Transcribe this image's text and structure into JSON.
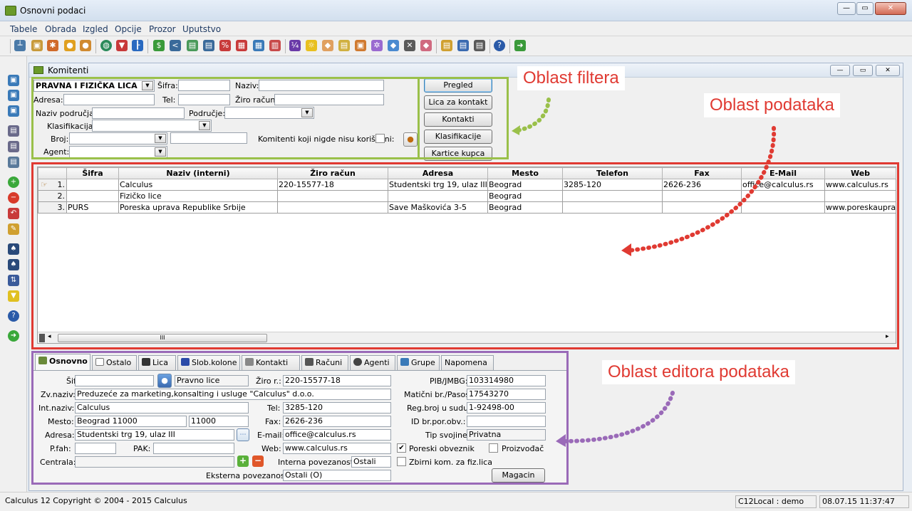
{
  "window": {
    "title": "Osnovni podaci"
  },
  "menu": [
    "Tabele",
    "Obrada",
    "Izgled",
    "Opcije",
    "Prozor",
    "Uputstvo"
  ],
  "child_window": {
    "title": "Komitenti"
  },
  "filter": {
    "type_value": "PRAVNA I FIZIČKA LICA",
    "sifra_label": "Šifra:",
    "naziv_label": "Naziv:",
    "adresa_label": "Adresa:",
    "tel_label": "Tel:",
    "ziro_label": "Žiro račun:",
    "naziv_podrucja_label": "Naziv područja:",
    "podrucje_label": "Područje:",
    "klasifikacija_label": "Klasifikacija:",
    "broj_label": "Broj:",
    "agent_label": "Agent:",
    "unused_label": "Komitenti koji nigde nisu korišćeni:"
  },
  "buttons": [
    "Pregled",
    "Lica za kontakt",
    "Kontakti",
    "Klasifikacije",
    "Kartice kupca"
  ],
  "callouts": {
    "filter": "Oblast filtera",
    "data": "Oblast podataka",
    "editor": "Oblast editora podataka"
  },
  "grid": {
    "columns": [
      "Šifra",
      "Naziv (interni)",
      "Žiro račun",
      "Adresa",
      "Mesto",
      "Telefon",
      "Fax",
      "E-Mail",
      "Web"
    ],
    "rows": [
      {
        "n": "1.",
        "sifra": "",
        "naziv": "Calculus",
        "ziro": "220-15577-18",
        "adresa": "Studentski trg 19, ulaz III",
        "mesto": "Beograd",
        "telefon": "3285-120",
        "fax": "2626-236",
        "email": "office@calculus.rs",
        "web": "www.calculus.rs"
      },
      {
        "n": "2.",
        "sifra": "",
        "naziv": "Fizičko lice",
        "ziro": "",
        "adresa": "",
        "mesto": "Beograd",
        "telefon": "",
        "fax": "",
        "email": "",
        "web": ""
      },
      {
        "n": "3.",
        "sifra": "PURS",
        "naziv": "Poreska uprava Republike Srbije",
        "ziro": "",
        "adresa": "Save Maškovića 3-5",
        "mesto": "Beograd",
        "telefon": "",
        "fax": "",
        "email": "",
        "web": "www.poreskauprava"
      }
    ],
    "hscroll_label": "III"
  },
  "tabs": [
    "Osnovno",
    "Ostalo",
    "Lica",
    "Slob.kolone",
    "Kontakti",
    "Računi",
    "Agenti",
    "Grupe",
    "Napomena"
  ],
  "editor": {
    "sifra_label": "Šifra:",
    "sifra_value": "",
    "tip_value": "Pravno lice",
    "ziro_label": "Žiro r.:",
    "ziro_value": "220-15577-18",
    "pib_label": "PIB/JMBG:",
    "pib_value": "103314980",
    "zvnaziv_label": "Zv.naziv:",
    "zvnaziv_value": "Preduzeće za marketing,konsalting i usluge \"Calculus\" d.o.o.",
    "maticni_label": "Matični br./Pasoš:",
    "maticni_value": "17543270",
    "intnaziv_label": "Int.naziv:",
    "intnaziv_value": "Calculus",
    "tel_label": "Tel:",
    "tel_value": "3285-120",
    "regbroj_label": "Reg.broj u sudu:",
    "regbroj_value": "1-92498-00",
    "mesto_label": "Mesto:",
    "mesto_value": "Beograd  11000",
    "ptt_value": "11000",
    "fax_label": "Fax:",
    "fax_value": "2626-236",
    "idbr_label": "ID br.por.obv.:",
    "idbr_value": "",
    "adresa_label": "Adresa:",
    "adresa_value": "Studentski trg 19, ulaz III",
    "email_label": "E-mail:",
    "email_value": "office@calculus.rs",
    "tipsvojine_label": "Tip svojine:",
    "tipsvojine_value": "Privatna",
    "pfah_label": "P.fah:",
    "pak_label": "PAK:",
    "web_label": "Web:",
    "web_value": "www.calculus.rs",
    "poreski_label": "Poreski obveznik",
    "proizvodjac_label": "Proizvođač",
    "centrala_label": "Centrala:",
    "interna_label": "Interna povezanost:",
    "interna_value": "Ostali",
    "zbirni_label": "Zbirni kom. za fiz.lica",
    "eksterna_label": "Eksterna povezanost:",
    "eksterna_value": "Ostali (O)",
    "magacin_label": "Magacin"
  },
  "status": {
    "copyright": "Calculus 12  Copyright © 2004 - 2015  Calculus",
    "db": "C12Local : demo",
    "datetime": "08.07.15 11:37:47"
  },
  "colors": {
    "filter_outline": "#9ac04a",
    "data_outline": "#e03a32",
    "editor_outline": "#9a6ab8",
    "filter_text": "#e03a32",
    "data_text": "#e03a32",
    "editor_text": "#e03a32"
  }
}
